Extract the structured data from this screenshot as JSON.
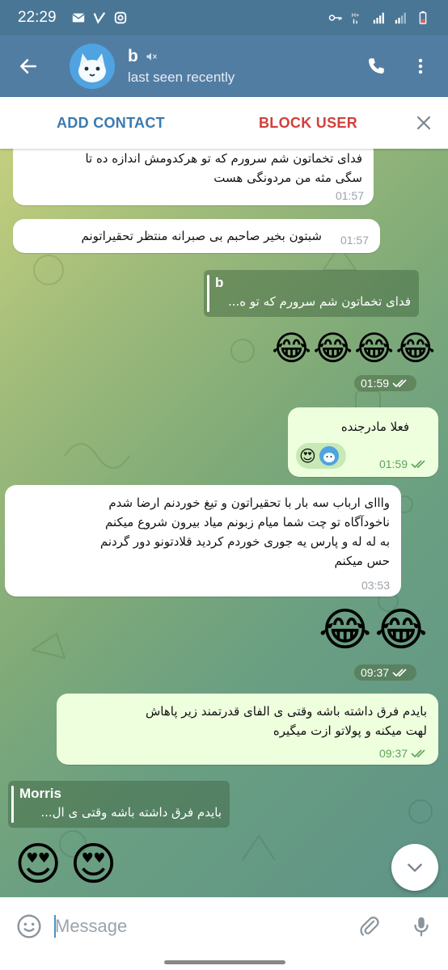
{
  "status_bar": {
    "time": "22:29"
  },
  "header": {
    "name": "b",
    "status": "last seen recently"
  },
  "action_bar": {
    "add_contact": "ADD CONTACT",
    "block_user": "BLOCK USER"
  },
  "messages": [
    {
      "dir": "in",
      "lines": [
        "فدای تخماتون شم سرورم که تو هرکدومش اندازه ده تا",
        "سگی مثه من مردونگی هست"
      ],
      "time": "01:57"
    },
    {
      "dir": "in",
      "lines": [
        "شبتون بخیر صاحبم بی صبرانه منتظر تحقیراتونم"
      ],
      "time": "01:57"
    },
    {
      "dir": "out",
      "reply_name": "b",
      "reply_text": "فدای تخماتون شم سرورم که تو ه...",
      "emojis": "😂😂😂😂",
      "time": "01:59"
    },
    {
      "dir": "out",
      "lines": [
        "فعلا مادرجنده"
      ],
      "reactions": "😍",
      "time": "01:59"
    },
    {
      "dir": "in",
      "lines": [
        "واااى ارباب سه بار با تحقیراتون و تیغ خوردنم ارضا شدم",
        "ناخودآگاه تو چت شما میام زبونم میاد بیرون شروع میکنم",
        "به له له و پارس یه جوری خوردم کردید قلادتونو دور گردنم",
        "حس میکنم"
      ],
      "time": "03:53"
    },
    {
      "dir": "out",
      "emojis": "😂😂",
      "time": "09:37"
    },
    {
      "dir": "out",
      "lines": [
        "بایدم فرق داشته باشه وقتی ی الفای قدرتمند زیر پاهاش",
        "لهت میکنه و پولاتو ازت میگیره"
      ],
      "time": "09:37"
    },
    {
      "dir": "in",
      "reply_name": "Morris",
      "reply_text": "بایدم فرق داشته باشه وقتی ی ال...",
      "emojis": "😍😍"
    }
  ],
  "composer": {
    "placeholder": "Message"
  },
  "icons": [
    "back-arrow-icon",
    "mute-icon",
    "phone-icon",
    "more-vert-icon",
    "close-icon",
    "emoji-icon",
    "attach-icon",
    "mic-icon",
    "chevron-down-icon",
    "double-check-icon"
  ],
  "colors": {
    "header": "#527da3",
    "status_bar": "#4a7696",
    "add_contact": "#3b7ab0",
    "block_user": "#d2403c",
    "outgoing_bubble": "#eeffde",
    "incoming_bubble": "#ffffff",
    "check": "#5ea35a"
  }
}
